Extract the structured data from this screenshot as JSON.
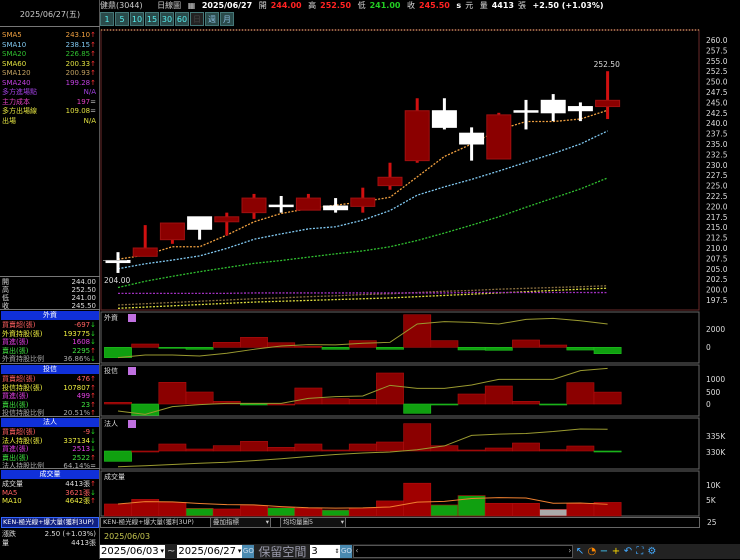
{
  "title": {
    "stock": "健鼎(3044)",
    "chart_type": "日線圖",
    "date": "2025/06/27",
    "open_label": "開",
    "open": "244.00",
    "high_label": "高",
    "high": "252.50",
    "low_label": "低",
    "low": "241.00",
    "close_label": "收",
    "close": "245.50",
    "s": "s",
    "unit": "元",
    "vol_label": "量",
    "volume": "4413",
    "vol_unit": "張",
    "change": "+2.50 (+1.03%)"
  },
  "timeframes": [
    "1",
    "5",
    "10",
    "15",
    "30",
    "60",
    "日",
    "週",
    "月"
  ],
  "left": {
    "date": "2025/06/27(五)",
    "ma_rows": [
      {
        "label": "SMA5",
        "value": "243.10",
        "arrow": "↑",
        "color": "#f0a040"
      },
      {
        "label": "SMA10",
        "value": "238.15",
        "arrow": "↑",
        "color": "#80c8f0"
      },
      {
        "label": "SMA20",
        "value": "226.85",
        "arrow": "↑",
        "color": "#30c030"
      },
      {
        "label": "SMA60",
        "value": "200.33",
        "arrow": "↑",
        "color": "#e0e040"
      },
      {
        "label": "SMA120",
        "value": "200.93",
        "arrow": "↑",
        "color": "#c0a060"
      },
      {
        "label": "SMA240",
        "value": "199.28",
        "arrow": "↑",
        "color": "#c040e0"
      },
      {
        "label": "多方進場點",
        "value": "N/A",
        "arrow": "",
        "color": "#a040e0"
      },
      {
        "label": "主力成本",
        "value": "197",
        "arrow": "=",
        "color": "#e040c0"
      },
      {
        "label": "多方出場線",
        "value": "109.08",
        "arrow": "=",
        "color": "#e0e040"
      },
      {
        "label": "出場",
        "value": "N/A",
        "arrow": "",
        "color": "#e0e040"
      }
    ],
    "ohlc": [
      {
        "label": "開",
        "value": "244.00"
      },
      {
        "label": "高",
        "value": "252.50"
      },
      {
        "label": "低",
        "value": "241.00"
      },
      {
        "label": "收",
        "value": "245.50"
      }
    ],
    "sections": [
      {
        "title": "外資",
        "rows": [
          {
            "label": "買賣超(張)",
            "value": "-697",
            "arrow": "↓",
            "color": "#ff6060"
          },
          {
            "label": "外資持股(張)",
            "value": "193775",
            "arrow": "↓",
            "color": "#f0f040"
          },
          {
            "label": "買進(張)",
            "value": "1608",
            "arrow": "↓",
            "color": "#e040e0"
          },
          {
            "label": "賣出(張)",
            "value": "2295",
            "arrow": "↑",
            "color": "#40e040"
          },
          {
            "label": "外資持股比例",
            "value": "36.86%",
            "arrow": "↓",
            "color": "#aaaaaa"
          }
        ]
      },
      {
        "title": "投信",
        "rows": [
          {
            "label": "買賣超(張)",
            "value": "476",
            "arrow": "↑",
            "color": "#ff6060"
          },
          {
            "label": "投信持股(張)",
            "value": "107807",
            "arrow": "↑",
            "color": "#f0f040"
          },
          {
            "label": "買進(張)",
            "value": "499",
            "arrow": "↑",
            "color": "#e040e0"
          },
          {
            "label": "賣出(張)",
            "value": "23",
            "arrow": "↑",
            "color": "#40e040"
          },
          {
            "label": "投信持股比例",
            "value": "20.51%",
            "arrow": "↑",
            "color": "#aaaaaa"
          }
        ]
      },
      {
        "title": "法人",
        "rows": [
          {
            "label": "買賣超(張)",
            "value": "-9",
            "arrow": "↓",
            "color": "#ff6060"
          },
          {
            "label": "法人持股(張)",
            "value": "337134",
            "arrow": "↓",
            "color": "#f0f040"
          },
          {
            "label": "買進(張)",
            "value": "2513",
            "arrow": "↓",
            "color": "#e040e0"
          },
          {
            "label": "賣出(張)",
            "value": "2522",
            "arrow": "↑",
            "color": "#40e040"
          },
          {
            "label": "法人持股比例",
            "value": "64.14%",
            "arrow": "=",
            "color": "#aaaaaa"
          }
        ]
      },
      {
        "title": "成交量",
        "rows": [
          {
            "label": "成交量",
            "value": "4413張",
            "arrow": "↑",
            "color": "#dddddd"
          },
          {
            "label": "MA5",
            "value": "3621張",
            "arrow": "↓",
            "color": "#ff6060"
          },
          {
            "label": "MA10",
            "value": "4642張",
            "arrow": "↑",
            "color": "#f0f040"
          }
        ]
      }
    ],
    "strategy": "KEN-極光線+爆大量(獲利3UP)",
    "change_label": "漲跌",
    "change": "2.50 (+1.03%)",
    "vol_label": "量",
    "volume": "4413張"
  },
  "colors": {
    "up": "#8b0000",
    "up_border": "#d01010",
    "down": "#ffffff",
    "sell": "#10a010",
    "neutral": "#aaaaaa",
    "header": "#1030d8"
  },
  "chart_data": [
    {
      "type": "candlestick",
      "ylim": [
        197.5,
        260
      ],
      "yticks_step": 2.5,
      "annotations": {
        "high": "252.50",
        "low": "204.00"
      },
      "candles": [
        [
          206.5,
          209,
          204,
          207,
          "white"
        ],
        [
          208,
          215.5,
          208,
          210,
          "red"
        ],
        [
          212,
          216,
          211,
          216,
          "red"
        ],
        [
          217.5,
          217.5,
          212,
          214.5,
          "white"
        ],
        [
          216.3,
          218.5,
          213,
          217.5,
          "red"
        ],
        [
          218.5,
          223,
          217,
          222,
          "red"
        ],
        [
          220.3,
          222.5,
          218.5,
          220.1,
          "white"
        ],
        [
          219.1,
          223,
          219.1,
          222,
          "red"
        ],
        [
          220.1,
          222,
          218.5,
          219.2,
          "white"
        ],
        [
          220,
          224.5,
          218.5,
          222,
          "red"
        ],
        [
          225,
          230.5,
          224,
          227,
          "red"
        ],
        [
          231,
          246,
          230.5,
          243,
          "red"
        ],
        [
          243,
          246,
          238.5,
          239,
          "white"
        ],
        [
          237.6,
          239,
          231,
          235,
          "white"
        ],
        [
          231.4,
          242.5,
          231.4,
          242,
          "red"
        ],
        [
          243,
          245.6,
          238.5,
          242.8,
          "white"
        ],
        [
          245.5,
          247,
          240.5,
          242.5,
          "white"
        ],
        [
          244,
          245,
          240.5,
          243,
          "white"
        ],
        [
          244,
          252.5,
          241,
          245.5,
          "red"
        ]
      ],
      "ma": [
        {
          "name": "SMA5",
          "color": "#f0a040",
          "values": [
            207.3,
            208.3,
            210.3,
            210.3,
            213.1,
            216.3,
            218.3,
            219.5,
            220.3,
            221.1,
            222.2,
            227.1,
            232,
            235,
            238.4,
            240.4,
            240.4,
            241,
            243.1
          ]
        },
        {
          "name": "SMA10",
          "color": "#80c8f0",
          "values": [
            205,
            206.2,
            207.1,
            208.1,
            209.9,
            212.1,
            213.4,
            214.6,
            215.1,
            216.7,
            219,
            222.7,
            224.7,
            226.5,
            228.5,
            230.6,
            232.7,
            235,
            238.15
          ]
        },
        {
          "name": "SMA20",
          "color": "#30c030",
          "values": [
            200.5,
            202,
            203.2,
            204.3,
            205.3,
            206.3,
            207,
            207.8,
            208.6,
            209.3,
            210.3,
            211.8,
            213.6,
            215.5,
            217.5,
            219.8,
            222,
            224.2,
            226.85
          ]
        },
        {
          "name": "SMA60",
          "color": "#e0e040",
          "values": [
            195.5,
            195.8,
            196.1,
            196.4,
            196.7,
            197,
            197.2,
            197.4,
            197.6,
            197.8,
            198,
            198.3,
            198.6,
            198.9,
            199.2,
            199.5,
            199.8,
            200.1,
            200.33
          ]
        },
        {
          "name": "SMA120",
          "color": "#8a7040",
          "values": [
            196.3,
            196.6,
            196.9,
            197.2,
            197.5,
            197.8,
            198,
            198.3,
            198.5,
            198.8,
            199,
            199.3,
            199.6,
            199.8,
            200.1,
            200.3,
            200.5,
            200.7,
            200.93
          ]
        },
        {
          "name": "SMA240",
          "color": "#a030c0",
          "values": [
            199.1,
            199.1,
            199.1,
            199.1,
            199.1,
            199.2,
            199.2,
            199.2,
            199.2,
            199.2,
            199.2,
            199.2,
            199.2,
            199.3,
            199.3,
            199.3,
            199.3,
            199.3,
            199.28
          ]
        }
      ]
    },
    {
      "type": "bar",
      "title": "外資",
      "yticks": [
        "2000",
        "0"
      ],
      "values": [
        -1130,
        360,
        -70,
        -220,
        545,
        1090,
        500,
        100,
        -220,
        730,
        -220,
        3560,
        730,
        -290,
        -330,
        800,
        250,
        -300,
        -697
      ],
      "line": [
        -1130,
        -840,
        -840,
        -950,
        -650,
        -220,
        145,
        290,
        260,
        440,
        545,
        2545,
        2800,
        2720,
        2545,
        3050,
        3160,
        2900,
        2545
      ]
    },
    {
      "type": "bar",
      "title": "投信",
      "yticks": [
        "1000",
        "500",
        "0"
      ],
      "values": [
        67,
        -453,
        867,
        480,
        107,
        -20,
        0,
        640,
        213,
        187,
        1240,
        -373,
        -10,
        400,
        720,
        107,
        -10,
        853,
        476
      ],
      "line": [
        -280,
        -413,
        -107,
        -27,
        27,
        27,
        27,
        227,
        293,
        320,
        747,
        627,
        627,
        760,
        987,
        987,
        987,
        1333,
        1427
      ]
    },
    {
      "type": "bar",
      "title": "法人",
      "yticks": [
        "335K",
        "330K"
      ],
      "values": [
        -31,
        0,
        21,
        6,
        16,
        29,
        11,
        21,
        3,
        21,
        27,
        82,
        16,
        3,
        9,
        24,
        4,
        15,
        -1
      ],
      "line": [
        325.4,
        325.7,
        326.1,
        326.5,
        326.8,
        327.3,
        327.9,
        328.6,
        329.2,
        329.7,
        330,
        330.7,
        331.9,
        335.2,
        335.6,
        335.8,
        336.4,
        337.2,
        337.1
      ]
    },
    {
      "type": "bar",
      "title": "成交量",
      "yticks": [
        "10K",
        "5K"
      ],
      "values": [
        3900,
        5400,
        4450,
        2500,
        2280,
        3370,
        2700,
        2500,
        1960,
        2600,
        4900,
        10650,
        3590,
        6630,
        4130,
        4130,
        2170,
        4130,
        4413
      ],
      "colors": [
        "red",
        "red",
        "red",
        "green",
        "red",
        "red",
        "green",
        "red",
        "green",
        "red",
        "red",
        "red",
        "green",
        "green",
        "red",
        "red",
        "gray",
        "red",
        "red"
      ]
    }
  ],
  "indicator_row": {
    "strategy": "KEN-極光線+爆大量(獲利3UP)",
    "overlay": "疊加指標",
    "volume_chart": "均均量圖5",
    "axis": "25"
  },
  "cursor_date": "2025/06/03",
  "bottom": {
    "from": "2025/06/03",
    "tilde": "~",
    "to": "2025/06/27",
    "go": "GO",
    "reserve_label": "保留空間",
    "reserve": "3"
  }
}
